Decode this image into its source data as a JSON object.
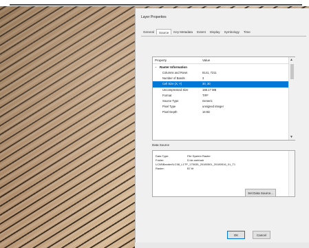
{
  "dialog": {
    "title": "Layer Properties",
    "tabs": [
      "General",
      "Source",
      "Key Metadata",
      "Extent",
      "Display",
      "Symbology",
      "Time"
    ],
    "active_tab": "Source",
    "grid": {
      "col_property": "Property",
      "col_value": "Value",
      "section": "Raster Information",
      "section_toggle": "−",
      "rows": [
        {
          "k": "Columns and Rows",
          "v": "8141, 7211"
        },
        {
          "k": "Number of Bands",
          "v": "3"
        },
        {
          "k": "Cell Size (X, Y)",
          "v": "30, 30"
        },
        {
          "k": "Uncompressed Size",
          "v": "168.17 MB"
        },
        {
          "k": "Format",
          "v": "TIFF"
        },
        {
          "k": "Source Type",
          "v": "Generic"
        },
        {
          "k": "Pixel Type",
          "v": "unsigned integer"
        },
        {
          "k": "Pixel Depth",
          "v": "16 Bit"
        }
      ],
      "selected_row": 2
    },
    "data_source": {
      "label": "Data Source",
      "rows": [
        {
          "k": "Data Type:",
          "v": "File System Raster"
        },
        {
          "k": "Folder:",
          "v": "D:\\dr-web\\adr"
        },
        {
          "k": "",
          "v": "LC08\\Banded\\LC08_L1TP_175035_20180501_20180516_01_T1"
        },
        {
          "k": "Raster:",
          "v": "B7.tif"
        }
      ],
      "set_button": "Set Data Source..."
    },
    "buttons": {
      "ok": "OK",
      "cancel": "Cancel"
    },
    "scroll_arrows": {
      "up": "▲",
      "down": "▼"
    }
  }
}
